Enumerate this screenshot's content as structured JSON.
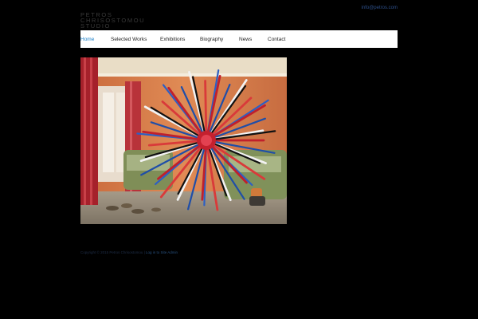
{
  "header": {
    "logo_lines": [
      "PETROS",
      "CHRISOSTOMOU",
      "STUDIO"
    ],
    "email": "info@petros.com"
  },
  "nav": {
    "items": [
      {
        "label": "Home",
        "active": true
      },
      {
        "label": "Selected Works",
        "active": false
      },
      {
        "label": "Exhibitions",
        "active": false
      },
      {
        "label": "Biography",
        "active": false
      },
      {
        "label": "News",
        "active": false
      },
      {
        "label": "Contact",
        "active": false
      }
    ]
  },
  "colors": {
    "background": "#000000",
    "nav_background": "#ffffff",
    "active_link": "#1a7fc8",
    "wall": "#d9804a"
  },
  "footer": {
    "copyright": "Copyright © 2015 Petros Chrisostomou",
    "separator": " | ",
    "link": "Log in to Site Admin"
  }
}
